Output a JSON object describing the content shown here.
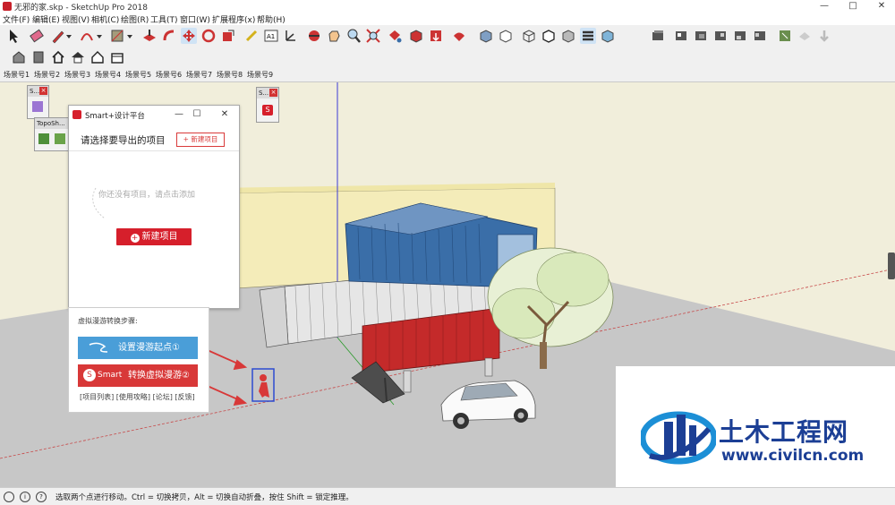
{
  "window": {
    "title": "无邪的家.skp - SketchUp Pro 2018",
    "minimize": "—",
    "maximize": "□",
    "close": "✕"
  },
  "menu": [
    "文件(F)",
    "编辑(E)",
    "视图(V)",
    "相机(C)",
    "绘图(R)",
    "工具(T)",
    "窗口(W)",
    "扩展程序(x)",
    "帮助(H)"
  ],
  "scene_tabs": [
    "场景号1",
    "场景号2",
    "场景号3",
    "场景号4",
    "场景号5",
    "场景号6",
    "场景号7",
    "场景号8",
    "场景号9"
  ],
  "panels": {
    "small_left_header": "S...",
    "topo_header": "TopoSh...",
    "small_right_header": "S..."
  },
  "dialog": {
    "title": "Smart+设计平台",
    "prompt": "请选择要导出的项目",
    "new_small": "+ 新建项目",
    "empty_hint": "你还没有项目，请点击添加",
    "new_big": "新建项目",
    "minimize": "—",
    "maximize": "☐",
    "close": "✕"
  },
  "lower_panel": {
    "steps_title": "虚拟漫游转换步骤:",
    "start_button": "设置漫游起点①",
    "convert_brand": "Smart",
    "convert_button": "转换虚拟漫游②",
    "links": "[项目列表] [使用攻略] [论坛] [反馈]"
  },
  "status": {
    "text": "选取两个点进行移动。Ctrl = 切换拷贝，Alt = 切换自动折叠，按住 Shift = 锁定推理。"
  },
  "watermark": {
    "title": "土木工程网",
    "url": "www.civilcn.com"
  },
  "colors": {
    "accent_red": "#d61f2b",
    "accent_blue": "#4a9ed8",
    "watermark_blue": "#1c3f95",
    "container_blue": "#3a6ea8",
    "container_red": "#c42a2a"
  }
}
